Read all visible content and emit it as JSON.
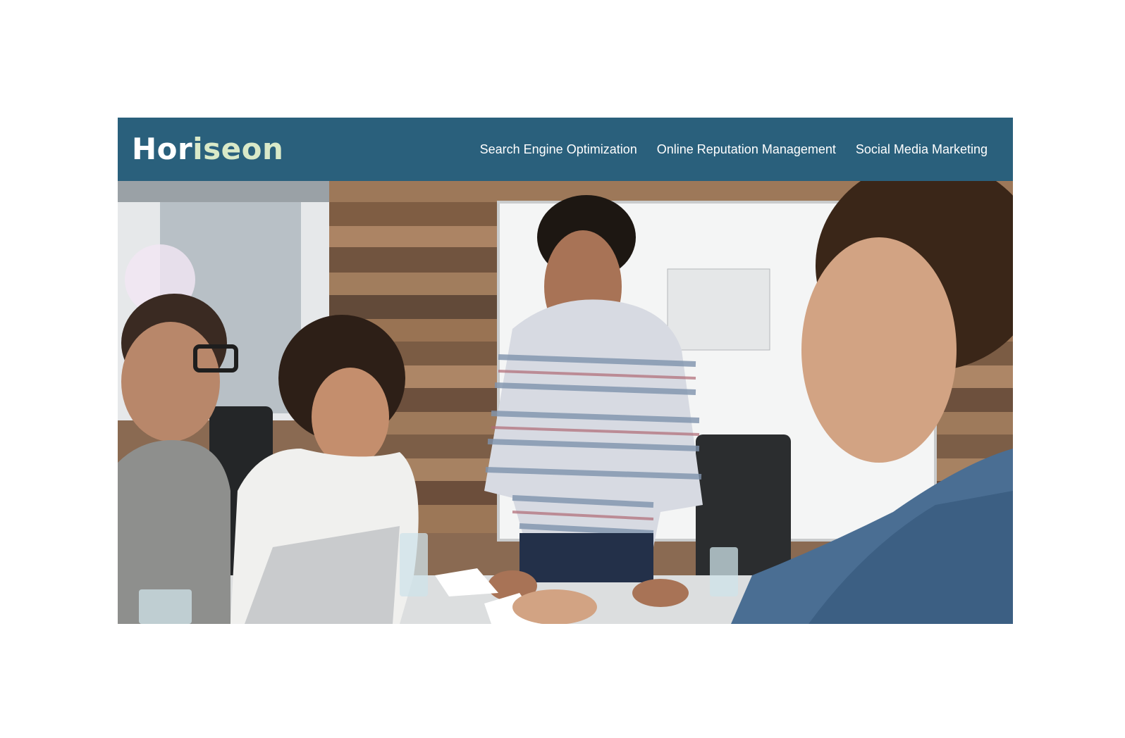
{
  "header": {
    "logo": {
      "part1": "Hor",
      "part2": "iseon"
    },
    "nav": [
      {
        "label": "Search Engine Optimization"
      },
      {
        "label": "Online Reputation Management"
      },
      {
        "label": "Social Media Marketing"
      }
    ]
  },
  "hero": {
    "image_description": "team of four people meeting around a table with laptop and whiteboard"
  },
  "colors": {
    "header_bg": "#2a607c",
    "logo_accent": "#d9e9c8",
    "text": "#ffffff"
  }
}
